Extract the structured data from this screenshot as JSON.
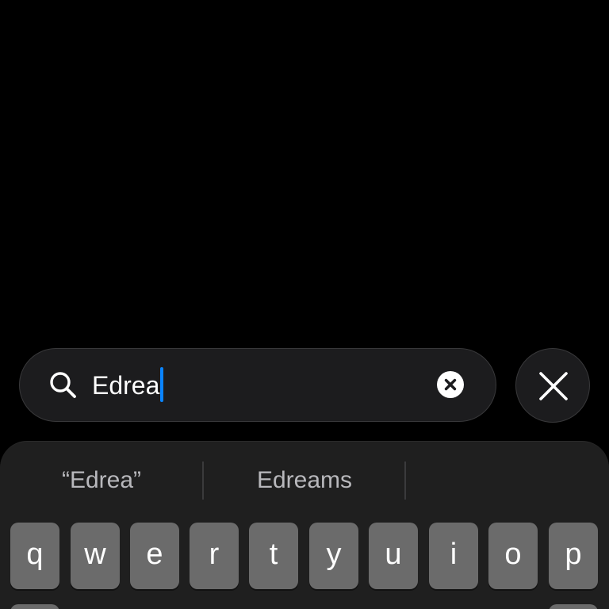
{
  "search": {
    "value": "Edrea",
    "clear_icon": "clear-circle-x-icon",
    "search_icon": "magnifying-glass-icon",
    "caret_color": "#0a84ff"
  },
  "close_button": {
    "icon": "close-x-icon"
  },
  "keyboard": {
    "suggestions": [
      "“Edrea”",
      "Edreams",
      ""
    ],
    "row1": [
      "q",
      "w",
      "e",
      "r",
      "t",
      "y",
      "u",
      "i",
      "o",
      "p"
    ]
  },
  "colors": {
    "background": "#000000",
    "field": "#1c1c1e",
    "keyboard": "#1f1f1f",
    "key": "#6b6b6b",
    "accent": "#0a84ff"
  }
}
